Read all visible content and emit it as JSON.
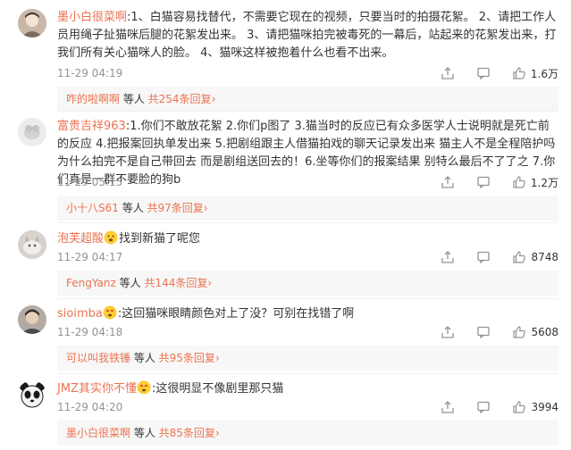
{
  "comments": [
    {
      "user": "墨小白很菜啊",
      "text": ":1、白猫容易找替代，不需要它现在的视频，只要当时的拍摄花絮。 2、请把工作人员用绳子扯猫咪后腿的花絮发出来。 3、请把猫咪拍完被毒死的一幕后，站起来的花絮发出来，打我们所有关心猫咪人的脸。 4、猫咪这样被抱着什么也看不出来。",
      "time": "11-29 04:19",
      "likes": "1.6万",
      "reply": {
        "user": "咋的啦啊啊",
        "mid": " 等人 ",
        "count": "共254条回复",
        "arrow": "›"
      }
    },
    {
      "user": "富贵吉祥963",
      "text": ":1.你们不敢放花絮 2.你们p图了 3.猫当时的反应已有众多医学人士说明就是死亡前的反应 4.把报案回执单发出来 5.把剧组跟主人借猫拍戏的聊天记录发出来 猫主人不是全程陪护吗 为什么拍完不是自己带回去 而是剧组送回去的！6.坐等你们的报案结果 别特么最后不了了之 7.你们真是一群不要脸的狗b",
      "time": "11-29 05:15",
      "likes": "1.2万",
      "reply": {
        "user": "小十八S61",
        "mid": " 等人 ",
        "count": "共97条回复",
        "arrow": "›"
      }
    },
    {
      "user": "泡芙超酸",
      "text": "找到新猫了呢您",
      "time": "11-29 04:17",
      "likes": "8748",
      "reply": {
        "user": "FengYanz",
        "mid": " 等人 ",
        "count": "共144条回复",
        "arrow": "›"
      }
    },
    {
      "user": "sioimba",
      "text": ":这回猫咪眼睛颜色对上了没？可别在找错了啊",
      "time": "11-29 04:18",
      "likes": "5608",
      "reply": {
        "user": "可以叫我铁锤",
        "mid": " 等人 ",
        "count": "共95条回复",
        "arrow": "›"
      }
    },
    {
      "user": "JMZ其实你不懂",
      "text": ":这很明显不像剧里那只猫",
      "time": "11-29 04:20",
      "likes": "3994",
      "reply": {
        "user": "墨小白很菜啊",
        "mid": " 等人 ",
        "count": "共85条回复",
        "arrow": "›"
      }
    }
  ],
  "icons": {
    "share": "share-icon",
    "comment": "comment-icon",
    "like": "like-icon",
    "emoji": "emoji-face-icon"
  },
  "colors": {
    "username": "#eb7350",
    "text": "#333333",
    "meta": "#939393",
    "reply_bg": "#f7f7f7"
  }
}
